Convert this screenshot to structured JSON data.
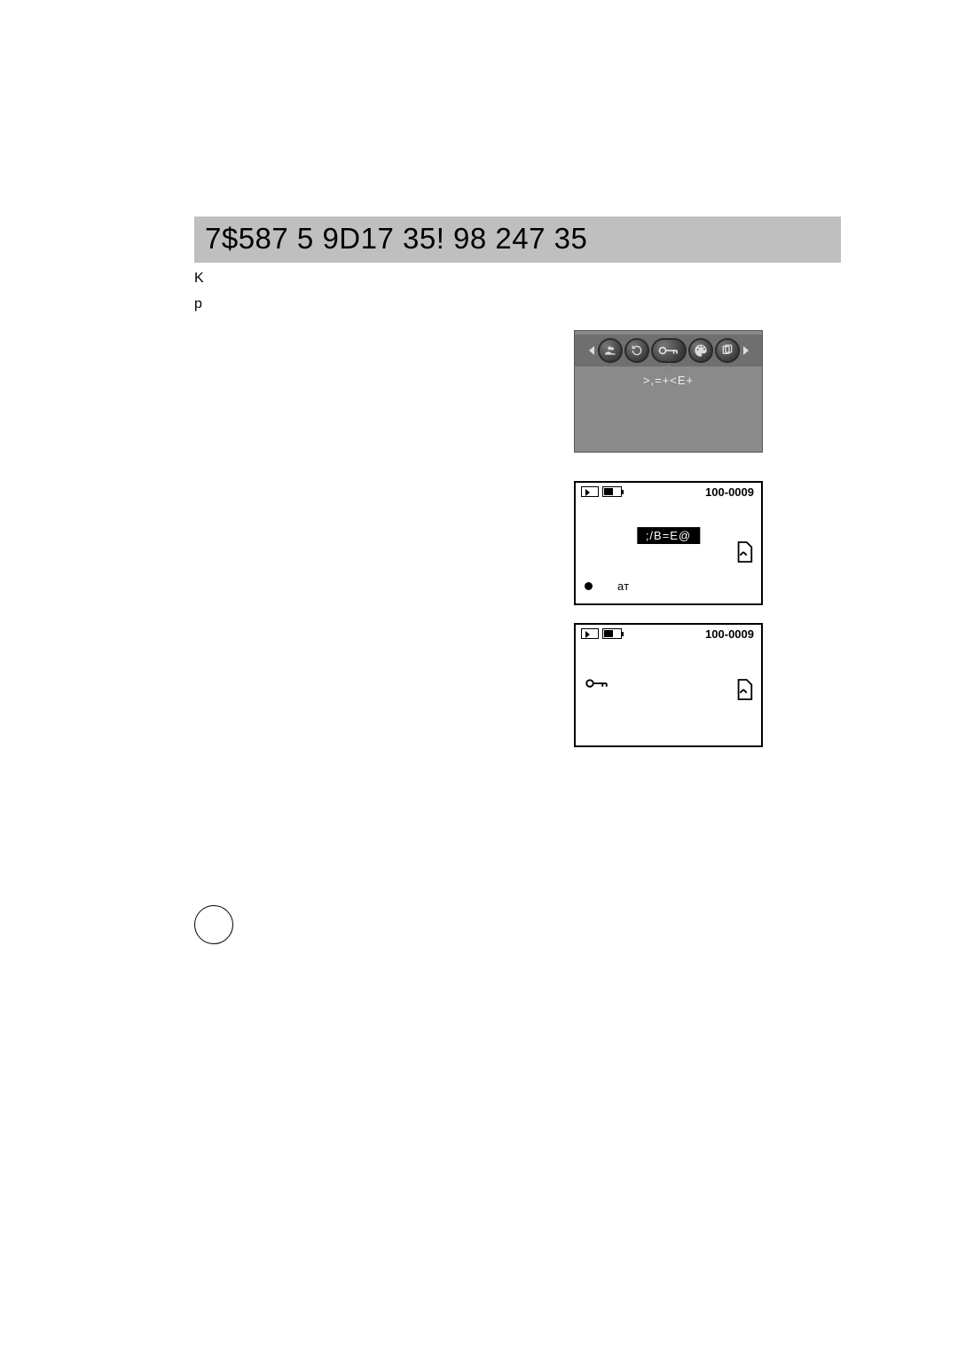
{
  "title": "7$587  5 9D17  35! 98 247  35",
  "paragraph1": "K",
  "paragraph2": "р",
  "menu_label": ">,=+<E+",
  "menu_icons": [
    "people-icon",
    "rotate-icon",
    "key-icon",
    "palette-icon",
    "copy-icon"
  ],
  "screen2": {
    "file_code": "100-0009",
    "center_label": ";/B=E@",
    "bottom_text": "aт"
  },
  "screen3": {
    "file_code": "100-0009"
  },
  "page_number": ""
}
